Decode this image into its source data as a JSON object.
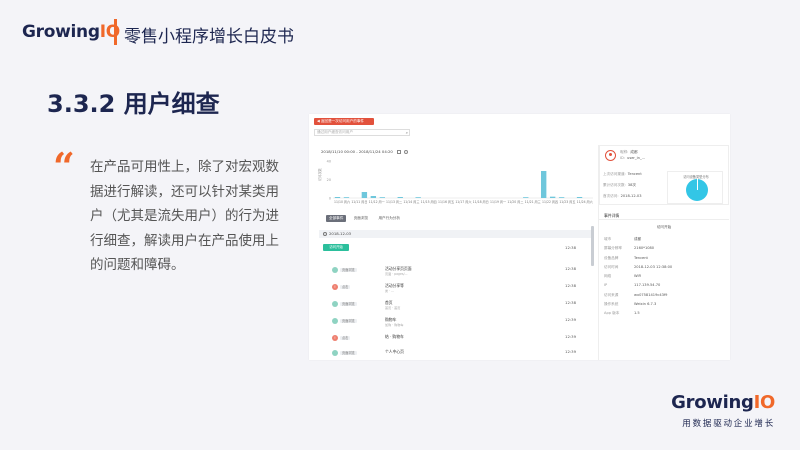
{
  "header": {
    "logo_main": "Growing",
    "logo_io": "IO",
    "title": "零售小程序增长白皮书"
  },
  "section": {
    "title": "3.3.2 用户细查"
  },
  "quote_mark": "“",
  "body_text": "在产品可用性上，除了对宏观数据进行解读，还可以针对某类用户（尤其是流失用户）的行为进行细查，解读用户在产品使用上的问题和障碍。",
  "footer": {
    "logo_main": "Growing",
    "logo_io": "IO",
    "tagline": "用数据驱动企业增长"
  },
  "colors": {
    "accent": "#f0682a",
    "navy": "#1d2650",
    "app_red": "#e2513c",
    "app_teal": "#2bbf9c",
    "app_blue": "#33c6e6"
  },
  "app": {
    "top_button": "◀ 返回是一次访问用户的事件",
    "search_placeholder": "通过用户细查访问用户",
    "date_range": "2018/11/10 00:00 - 2018/11/24 04:20",
    "tabs": [
      "全部事件",
      "页面浏览",
      "用户行为分析"
    ],
    "timeline": {
      "date": "2018-12-03",
      "start_label": "访问开始",
      "start_time": "12:38",
      "events": [
        {
          "dot": "green",
          "icon": "",
          "type": "页面浏览",
          "title": "活动分享页页面",
          "sub": "页面 · pages/...",
          "time": "12:38"
        },
        {
          "dot": "red",
          "icon": "!",
          "type": "点击",
          "title": "活动分享等",
          "sub": "类 · ...",
          "time": "12:38"
        },
        {
          "dot": "green",
          "icon": "",
          "type": "页面浏览",
          "title": "首页",
          "sub": "首页 · 首页",
          "time": "12:38"
        },
        {
          "dot": "green",
          "icon": "",
          "type": "页面浏览",
          "title": "购物车",
          "sub": "加购 · 购物车",
          "time": "12:39"
        },
        {
          "dot": "red",
          "icon": "!",
          "type": "点击",
          "title": "结 · 购物车",
          "sub": "",
          "time": "12:39"
        },
        {
          "dot": "green",
          "icon": "",
          "type": "页面浏览",
          "title": "个人中心页",
          "sub": "",
          "time": "12:39"
        }
      ]
    },
    "user": {
      "rows": [
        {
          "k": "昵称:",
          "v": "成都"
        },
        {
          "k": "ID:",
          "v": "user_in_..."
        }
      ],
      "stats": [
        {
          "k": "上次访问渠道:",
          "v": "Tencent"
        },
        {
          "k": "累计访问次数:",
          "v": "38次"
        },
        {
          "k": "首次访问:",
          "v": "2018-12-03"
        }
      ],
      "pie_title": "访问设备类型分布"
    },
    "detail": {
      "heading": "事件详情",
      "start_label": "访问开始",
      "rows": [
        {
          "k": "城市",
          "v": "成都"
        },
        {
          "k": "屏幕分辨率",
          "v": "2160*1080"
        },
        {
          "k": "设备品牌",
          "v": "Tencent"
        },
        {
          "k": "访问时间",
          "v": "2018-12-03 12:38:00"
        },
        {
          "k": "网络",
          "v": "WiFi"
        },
        {
          "k": "IP",
          "v": "117.139.54.70"
        },
        {
          "k": "访问来源",
          "v": "wx07581419c43f9"
        },
        {
          "k": "操作系统",
          "v": "Weixin 6.7.3"
        },
        {
          "k": "App 版本",
          "v": "1.5"
        }
      ]
    },
    "chart_data": {
      "type": "bar",
      "categories": [
        "11/10 周六",
        "11/11 周日",
        "11/12 周一",
        "11/13 周二",
        "11/14 周三",
        "11/15 周四",
        "11/16 周五",
        "11/17 周六",
        "11/18 周日",
        "11/19 周一",
        "11/20 周二",
        "11/21 周三",
        "11/22 周四",
        "11/23 周五",
        "11/24 周六"
      ],
      "series": [
        {
          "values": [
            0.3,
            0.2,
            0,
            1.8,
            0.6,
            0.2,
            0,
            0.3,
            0,
            0.1,
            0,
            0,
            0,
            0,
            0,
            0,
            0,
            0,
            0,
            0,
            0,
            0.2,
            0,
            10.5,
            0.4,
            0.2,
            0,
            0.3,
            0
          ]
        }
      ],
      "yticks": [
        "40",
        "20",
        "0"
      ],
      "ylabel": "访问次数",
      "ylim": [
        0,
        40
      ],
      "grid": false
    }
  }
}
